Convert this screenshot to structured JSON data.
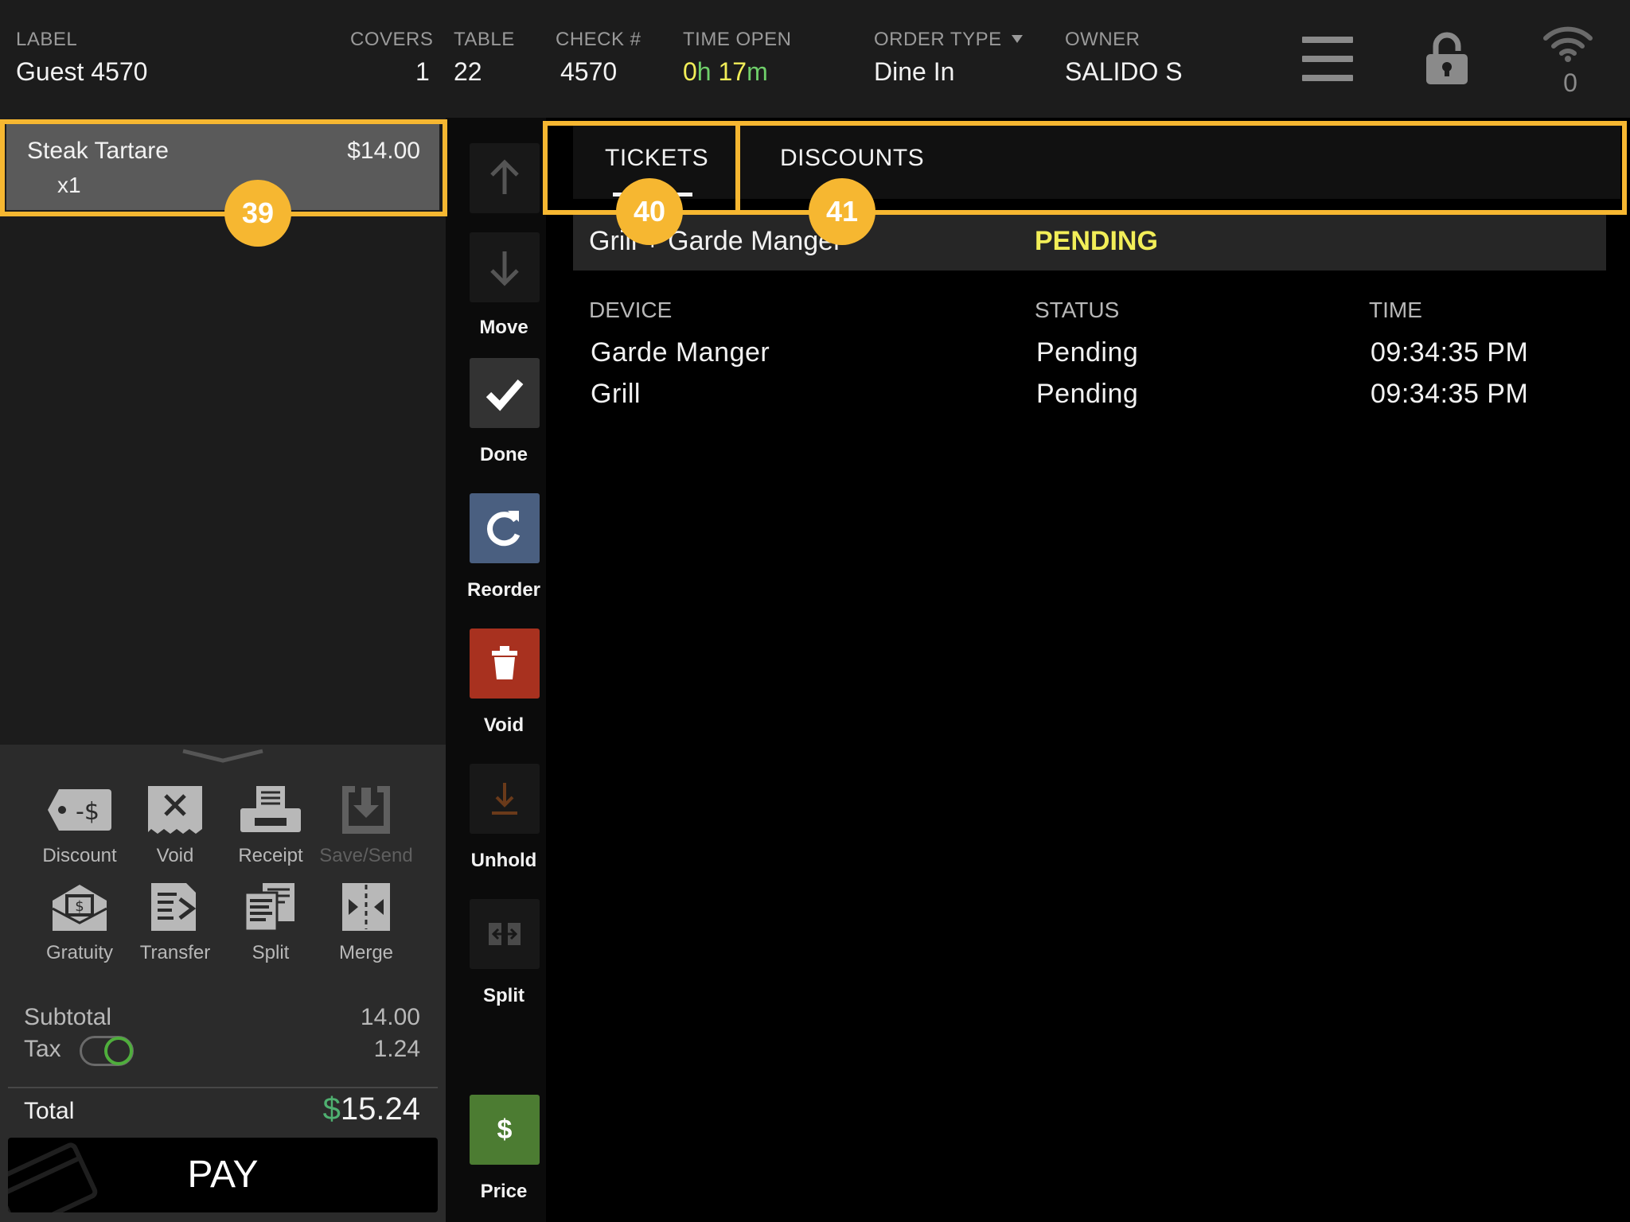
{
  "header": {
    "label": {
      "caption": "LABEL",
      "value": "Guest 4570"
    },
    "covers": {
      "caption": "COVERS",
      "value": "1"
    },
    "table": {
      "caption": "TABLE",
      "value": "22"
    },
    "check": {
      "caption": "CHECK #",
      "value": "4570"
    },
    "time_open": {
      "caption": "TIME OPEN",
      "hours": "0",
      "h_unit": "h",
      "minutes": "17",
      "m_unit": "m"
    },
    "order_type": {
      "caption": "ORDER TYPE",
      "value": "Dine In"
    },
    "owner": {
      "caption": "OWNER",
      "value": "SALIDO S"
    },
    "wifi_count": "0",
    "icons": {
      "menu": "hamburger-menu-icon",
      "lock": "lock-icon",
      "wifi": "wifi-icon"
    }
  },
  "order": {
    "items": [
      {
        "name": "Steak Tartare",
        "price": "$14.00",
        "qty": "x1"
      }
    ]
  },
  "tools": [
    {
      "label": "Discount",
      "icon": "discount-tag-icon"
    },
    {
      "label": "Void",
      "icon": "void-receipt-icon"
    },
    {
      "label": "Receipt",
      "icon": "printer-icon"
    },
    {
      "label": "Save/Send",
      "icon": "save-send-icon",
      "disabled": true
    },
    {
      "label": "Gratuity",
      "icon": "gratuity-envelope-icon"
    },
    {
      "label": "Transfer",
      "icon": "transfer-icon"
    },
    {
      "label": "Split",
      "icon": "split-check-icon"
    },
    {
      "label": "Merge",
      "icon": "merge-icon"
    }
  ],
  "summary": {
    "subtotal_label": "Subtotal",
    "subtotal": "14.00",
    "tax_label": "Tax",
    "tax": "1.24",
    "tax_enabled": true,
    "total_label": "Total",
    "currency": "$",
    "total": "15.24",
    "pay_label": "PAY"
  },
  "actions": [
    {
      "label": "Move",
      "icon": "arrow-up-icon"
    },
    {
      "label": "Done",
      "icon": "check-icon"
    },
    {
      "label": "Reorder",
      "icon": "reorder-icon"
    },
    {
      "label": "Void",
      "icon": "trash-icon"
    },
    {
      "label": "Unhold",
      "icon": "unhold-icon"
    },
    {
      "label": "Split",
      "icon": "split-item-icon"
    },
    {
      "label": "Price",
      "icon": "dollar-icon",
      "glyph": "$"
    }
  ],
  "tabs": [
    {
      "label": "TICKETS",
      "active": true
    },
    {
      "label": "DISCOUNTS",
      "active": false
    }
  ],
  "tickets": {
    "row_name": "Grill + Garde Manger",
    "row_status": "PENDING",
    "columns": [
      "DEVICE",
      "STATUS",
      "TIME"
    ],
    "rows": [
      {
        "device": "Garde Manger",
        "status": "Pending",
        "time": "09:34:35 PM"
      },
      {
        "device": "Grill",
        "status": "Pending",
        "time": "09:34:35 PM"
      }
    ]
  },
  "callouts": [
    "39",
    "40",
    "41"
  ],
  "colors": {
    "highlight": "#f6b731",
    "pending": "#f2ee58",
    "done_green": "#4fae3c",
    "reorder_blue": "#4a5f80",
    "void_red": "#a8311f",
    "price_green": "#4c7c32"
  }
}
